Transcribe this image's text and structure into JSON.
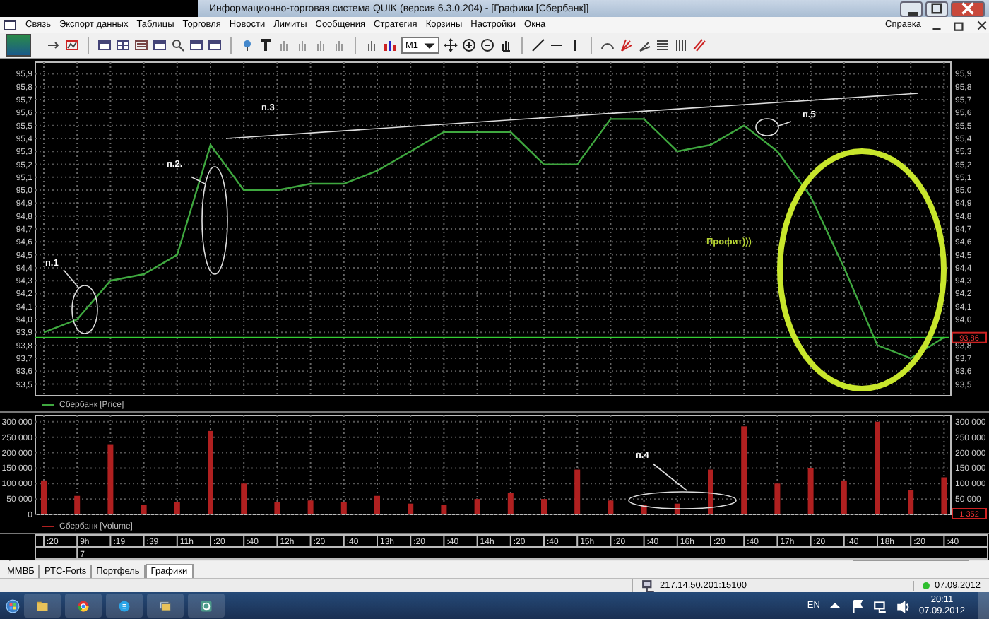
{
  "window": {
    "title": "Информационно-торговая система QUIK (версия 6.3.0.204) - [Графики [Сбербанк]]"
  },
  "menu": [
    "Связь",
    "Экспорт данных",
    "Таблицы",
    "Торговля",
    "Новости",
    "Лимиты",
    "Сообщения",
    "Стратегия",
    "Корзины",
    "Настройки",
    "Окна"
  ],
  "menu_right": "Справка",
  "toolbar": {
    "interval": "M1"
  },
  "price_panel": {
    "chart_data": {
      "type": "line",
      "grid": true,
      "series": [
        {
          "name": "Сбербанк [Price]",
          "color": "#3fa83f",
          "values": [
            93.9,
            94.0,
            94.3,
            94.35,
            94.5,
            95.35,
            95.0,
            95.0,
            95.05,
            95.05,
            95.15,
            95.3,
            95.45,
            95.45,
            95.45,
            95.2,
            95.2,
            95.55,
            95.55,
            95.3,
            95.35,
            95.5,
            95.3,
            94.95,
            94.4,
            93.8,
            93.7,
            93.86
          ]
        }
      ],
      "ylim": [
        93.41,
        95.99
      ],
      "yticks": [
        {
          "value": 95.9,
          "label": "95,9"
        },
        {
          "value": 95.8,
          "label": "95,8"
        },
        {
          "value": 95.7,
          "label": "95,7"
        },
        {
          "value": 95.6,
          "label": "95,6"
        },
        {
          "value": 95.5,
          "label": "95,5"
        },
        {
          "value": 95.4,
          "label": "95,4"
        },
        {
          "value": 95.3,
          "label": "95,3"
        },
        {
          "value": 95.2,
          "label": "95,2"
        },
        {
          "value": 95.1,
          "label": "95,1"
        },
        {
          "value": 95.0,
          "label": "95,0"
        },
        {
          "value": 94.9,
          "label": "94,9"
        },
        {
          "value": 94.8,
          "label": "94,8"
        },
        {
          "value": 94.7,
          "label": "94,7"
        },
        {
          "value": 94.6,
          "label": "94,6"
        },
        {
          "value": 94.5,
          "label": "94,5"
        },
        {
          "value": 94.4,
          "label": "94,4"
        },
        {
          "value": 94.3,
          "label": "94,3"
        },
        {
          "value": 94.2,
          "label": "94,2"
        },
        {
          "value": 94.1,
          "label": "94,1"
        },
        {
          "value": 94.0,
          "label": "94,0"
        },
        {
          "value": 93.9,
          "label": "93,9"
        },
        {
          "value": 93.8,
          "label": "93,8"
        },
        {
          "value": 93.7,
          "label": "93,7"
        },
        {
          "value": 93.6,
          "label": "93,6"
        },
        {
          "value": 93.5,
          "label": "93,5"
        }
      ],
      "ref_lines": [
        {
          "axis": "y",
          "value": 93.86,
          "label": "93,86"
        }
      ],
      "annotations": [
        "п.1",
        "п.2.",
        "п.3",
        "п.5",
        "Профит)))"
      ]
    },
    "right_axis_labels": [
      "95,9",
      "95,8",
      "95,7",
      "95,6",
      "95,5",
      "95,4",
      "95,3",
      "95,2",
      "95,1",
      "95,0",
      "94,9",
      "94,8",
      "94,7",
      "94,6",
      "94,5",
      "94,4",
      "94,3",
      "94,2",
      "94,1",
      "94,0",
      "93,8",
      "93,7",
      "93,6",
      "93,5"
    ]
  },
  "volume_panel": {
    "chart_data": {
      "type": "bar",
      "grid": true,
      "categories": [
        ":20",
        "9h",
        ":19",
        ":39",
        "11h",
        ":20",
        ":40",
        "12h",
        ":20",
        ":40",
        "13h",
        ":20",
        ":40",
        "14h",
        ":20",
        ":40",
        "15h",
        ":20",
        ":40",
        "16h",
        ":20",
        ":40",
        "17h",
        ":20",
        ":40",
        "18h",
        ":20",
        ":40"
      ],
      "series": [
        {
          "name": "Сбербанк [Volume]",
          "color": "#b02020",
          "values": [
            110000,
            60000,
            225000,
            30000,
            40000,
            270000,
            100000,
            40000,
            45000,
            40000,
            60000,
            35000,
            30000,
            50000,
            70000,
            50000,
            145000,
            45000,
            30000,
            35000,
            145000,
            285000,
            100000,
            150000,
            110000,
            300000,
            80000,
            120000
          ]
        }
      ],
      "ylim": [
        0,
        320000
      ],
      "yticks": [
        {
          "value": 300000,
          "label": "300 000"
        },
        {
          "value": 250000,
          "label": "250 000"
        },
        {
          "value": 200000,
          "label": "200 000"
        },
        {
          "value": 150000,
          "label": "150 000"
        },
        {
          "value": 100000,
          "label": "100 000"
        },
        {
          "value": 50000,
          "label": "50 000"
        },
        {
          "value": 0,
          "label": "0"
        }
      ],
      "annotations": [
        "п.4"
      ]
    },
    "right_axis_labels": [
      "300 000",
      "250 000",
      "200 000",
      "150 000",
      "100 000",
      "50 000"
    ],
    "value_tag": "1 352"
  },
  "time_axis": {
    "day_label": "7"
  },
  "tabs": [
    {
      "label": "ММВБ",
      "selected": false
    },
    {
      "label": "РТС-Forts",
      "selected": false
    },
    {
      "label": "Портфель",
      "selected": false
    },
    {
      "label": "Графики",
      "selected": true
    }
  ],
  "status_bar": {
    "server": "217.14.50.201:15100",
    "date": "07.09.2012"
  },
  "taskbar": {
    "language": "EN",
    "time": "20:11",
    "date": "07.09.2012"
  }
}
